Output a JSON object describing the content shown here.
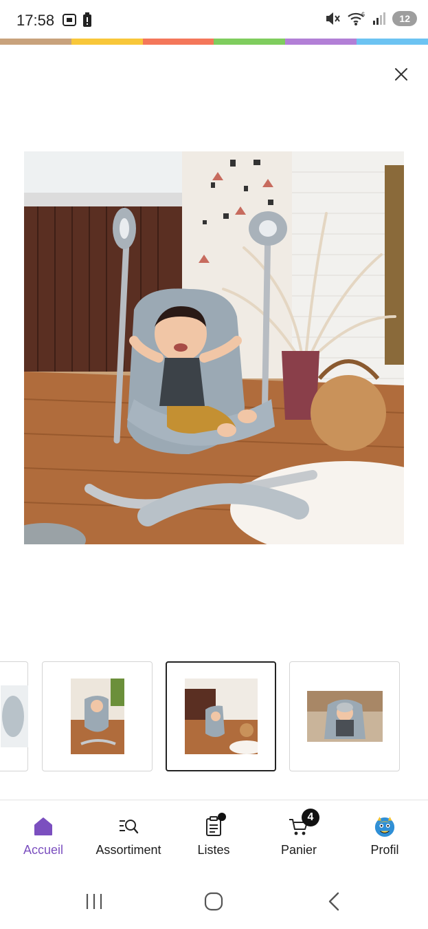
{
  "status_bar": {
    "time": "17:58",
    "battery": "12",
    "network": "6"
  },
  "rainbow_colors": [
    "#c8a27c",
    "#f8c73a",
    "#f4775a",
    "#7fcd5e",
    "#b27fd6",
    "#6cc3f2"
  ],
  "colors": {
    "accent": "#7b4fbf",
    "badge": "#111111"
  },
  "modal": {
    "close_icon": "close-icon"
  },
  "gallery": {
    "selected_index": 2
  },
  "bottom_nav": {
    "items": [
      {
        "label": "Accueil",
        "icon": "home-icon",
        "active": true
      },
      {
        "label": "Assortiment",
        "icon": "search-list-icon"
      },
      {
        "label": "Listes",
        "icon": "list-icon"
      },
      {
        "label": "Panier",
        "icon": "cart-icon",
        "badge": "4"
      },
      {
        "label": "Profil",
        "icon": "avatar-monster-icon"
      }
    ]
  },
  "android_nav": {
    "items": [
      "recents-icon",
      "home-circle-icon",
      "back-icon"
    ]
  }
}
